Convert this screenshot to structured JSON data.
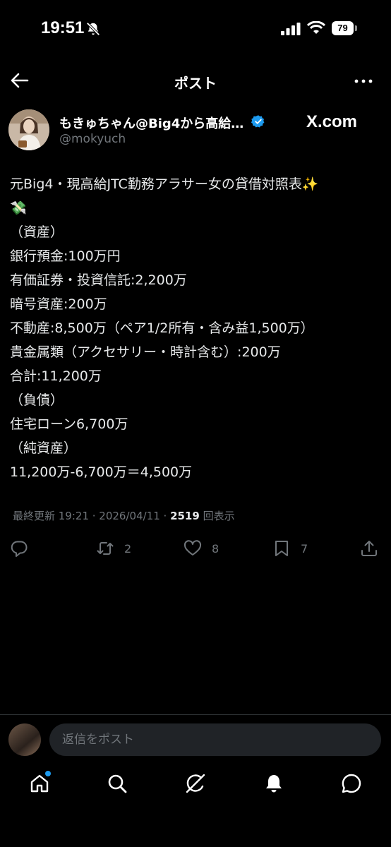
{
  "status": {
    "time": "19:51",
    "battery": "79"
  },
  "header": {
    "title": "ポスト"
  },
  "author": {
    "name": "もきゅちゃん@Big4から高給…",
    "handle": "@mokyuch",
    "watermark": "X.com"
  },
  "post": {
    "lines": [
      "元Big4・現高給JTC勤務アラサー女の貸借対照表✨",
      "💸",
      "（資産）",
      "銀行預金:100万円",
      "有価証券・投資信託:2,200万",
      "暗号資産:200万",
      "不動産:8,500万（ペア1/2所有・含み益1,500万）",
      "貴金属類（アクセサリー・時計含む）:200万",
      "合計:11,200万",
      "（負債）",
      "住宅ローン6,700万",
      "（純資産）",
      "11,200万-6,700万＝4,500万"
    ],
    "meta_prefix": "最終更新 19:21 · 2026/04/11 · ",
    "views": "2519",
    "views_label": " 回表示"
  },
  "actions": {
    "retweets": "2",
    "likes": "8",
    "bookmarks": "7"
  },
  "reply": {
    "placeholder": "返信をポスト"
  },
  "colors": {
    "accent": "#1d9bf0",
    "background": "#000000",
    "muted": "#71767b"
  },
  "icons": [
    "back-arrow-icon",
    "more-icon",
    "verified-badge-icon",
    "reply-icon",
    "retweet-icon",
    "like-icon",
    "bookmark-icon",
    "share-icon",
    "home-icon",
    "search-icon",
    "grok-icon",
    "notifications-icon",
    "messages-icon"
  ]
}
